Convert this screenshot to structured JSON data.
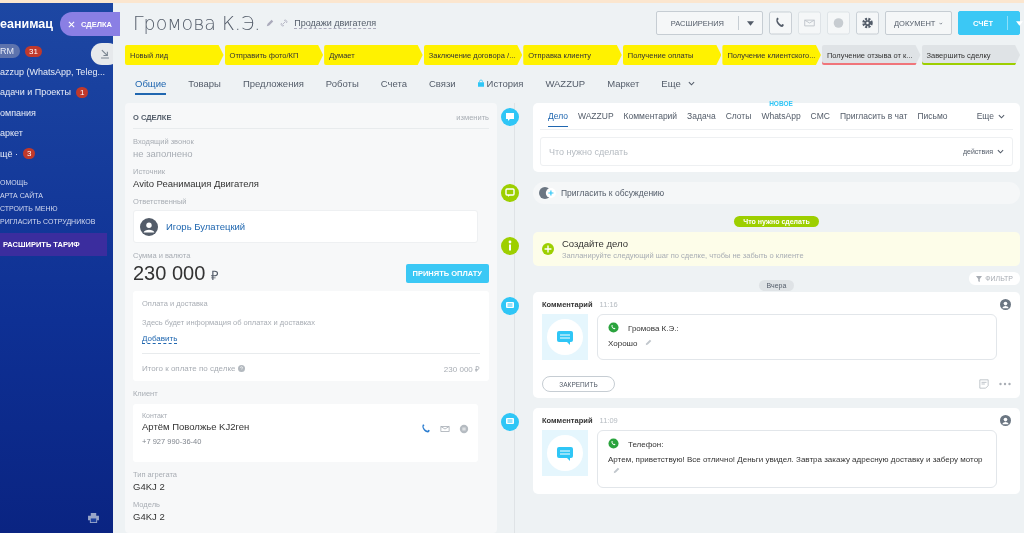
{
  "sidebar": {
    "logo": "еанимац",
    "items": [
      {
        "label": "RM",
        "selected": true,
        "badge": "31"
      },
      {
        "label": "azzup (WhatsApp, Teleg...",
        "selected": false
      },
      {
        "label": "адачи и Проекты",
        "selected": false,
        "badge": "1"
      },
      {
        "label": "омпания",
        "selected": false
      },
      {
        "label": "аркет",
        "selected": false
      },
      {
        "label": "щё ·",
        "selected": false,
        "badge": "3"
      }
    ],
    "links": [
      "ОМОЩЬ",
      "АРТА САЙТА",
      "СТРОИТЬ МЕНЮ",
      "РИГЛАСИТЬ СОТРУДНИКОВ"
    ],
    "upgrade": "РАСШИРИТЬ ТАРИФ",
    "close_chip": "СДЕЛКА"
  },
  "header": {
    "title": "Громова К.Э.",
    "pipeline": "Продажи двигателя",
    "extensions": "РАСШИРЕНИЯ",
    "document": "ДОКУМЕНТ",
    "invoice": "СЧЁТ"
  },
  "stages": [
    {
      "label": "Новый лид",
      "color": "#fff200",
      "kind": "step"
    },
    {
      "label": "Отправить фото/КП",
      "color": "#fff200",
      "kind": "step"
    },
    {
      "label": "Думает",
      "color": "#fff200",
      "kind": "step"
    },
    {
      "label": "Заключение договора /...",
      "color": "#fff200",
      "kind": "step"
    },
    {
      "label": "Отправка клиенту",
      "color": "#fff200",
      "kind": "step"
    },
    {
      "label": "Получение оплаты",
      "color": "#fff200",
      "kind": "step"
    },
    {
      "label": "Получение клиентского...",
      "color": "#fff200",
      "kind": "step"
    },
    {
      "label": "Получение отзыва от к...",
      "color": "#dfe3e6",
      "kind": "fail"
    },
    {
      "label": "Завершить сделку",
      "color": "#dfe3e6",
      "kind": "success"
    }
  ],
  "tabs": [
    {
      "label": "Общие",
      "selected": true,
      "kind": "plain"
    },
    {
      "label": "Товары",
      "selected": false,
      "kind": "plain"
    },
    {
      "label": "Предложения",
      "selected": false,
      "kind": "plain"
    },
    {
      "label": "Роботы",
      "selected": false,
      "kind": "plain"
    },
    {
      "label": "Счета",
      "selected": false,
      "kind": "plain"
    },
    {
      "label": "Связи",
      "selected": false,
      "kind": "plain"
    },
    {
      "label": "История",
      "selected": false,
      "kind": "locked"
    },
    {
      "label": "WAZZUP",
      "selected": false,
      "kind": "plain"
    },
    {
      "label": "Маркет",
      "selected": false,
      "kind": "plain"
    },
    {
      "label": "Еще",
      "selected": false,
      "kind": "more"
    }
  ],
  "deal": {
    "title": "О СДЕЛКЕ",
    "edit": "изменить",
    "fields": [
      {
        "label": "Входящий звонок",
        "value": "не заполнено",
        "kind": "empty"
      },
      {
        "label": "Источник",
        "value": "Avito Реанимация Двигателя",
        "kind": "text"
      },
      {
        "label": "Ответственный",
        "value": "Игорь Булатецкий",
        "kind": "person"
      }
    ],
    "amount_label": "Сумма и валюта",
    "amount": "230 000",
    "currency": "₽",
    "pay_button": "ПРИНЯТЬ ОПЛАТУ",
    "payment": {
      "title": "Оплата и доставка",
      "info": "Здесь будет информация об оплатах и доставках",
      "add": "Добавить",
      "total_label": "Итого к оплате по сделке",
      "total": "230 000 ₽"
    },
    "client_label": "Клиент",
    "contact": {
      "label": "Контакт",
      "name": "Артём Поволжье KJ2ген",
      "phone": "+7 927 990-36-40"
    },
    "extra": [
      {
        "label": "Тип агрегата",
        "value": "G4KJ 2"
      },
      {
        "label": "Модель",
        "value": "G4KJ 2"
      }
    ]
  },
  "timeline": {
    "tabs": [
      {
        "label": "Дело",
        "selected": true
      },
      {
        "label": "WAZZUP",
        "selected": false
      },
      {
        "label": "Комментарий",
        "selected": false
      },
      {
        "label": "Задача",
        "selected": false
      },
      {
        "label": "Слоты",
        "selected": false
      },
      {
        "label": "WhatsApp",
        "selected": false,
        "badge": "НОВОЕ"
      },
      {
        "label": "СМС",
        "selected": false
      },
      {
        "label": "Пригласить в чат",
        "selected": false
      },
      {
        "label": "Письмо",
        "selected": false
      }
    ],
    "more": "Еще",
    "placeholder": "Что нужно сделать",
    "actions": "действия",
    "invite": "Пригласить к обсуждению",
    "todo_pill": "Что нужно сделать",
    "create_title": "Создайте дело",
    "create_hint": "Запланируйте следующий шаг по сделке, чтобы не забыть о клиенте",
    "day": "Вчера",
    "filter": "ФИЛЬТР",
    "comments": [
      {
        "type": "Комментарий",
        "time": "11:16",
        "author": "Громова К.Э.:",
        "text": "Хорошо",
        "pin": "ЗАКРЕПИТЬ"
      },
      {
        "type": "Комментарий",
        "time": "11:09",
        "author": "Телефон:",
        "text": "Артем, приветствую! Все отлично! Деньги увидел. Завтра закажу адресную доставку и заберу мотор"
      }
    ]
  }
}
